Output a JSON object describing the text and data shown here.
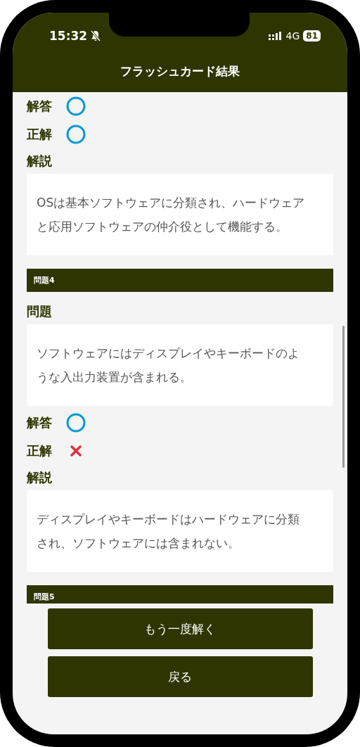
{
  "status_bar": {
    "time": "15:32",
    "silent": true,
    "network": "4G",
    "battery": "81"
  },
  "header": {
    "title": "フラッシュカード結果"
  },
  "questions": [
    {
      "answer_label": "解答",
      "answer_ok": true,
      "correct_label": "正解",
      "correct_ok": true,
      "explanation_label": "解説",
      "explanation": "OSは基本ソフトウェアに分類され、ハードウェアと応用ソフトウェアの仲介役として機能する。"
    },
    {
      "heading": "問題4",
      "question_label": "問題",
      "question": "ソフトウェアにはディスプレイやキーボードのような入出力装置が含まれる。",
      "answer_label": "解答",
      "answer_ok": true,
      "correct_label": "正解",
      "correct_ok": false,
      "explanation_label": "解説",
      "explanation": "ディスプレイやキーボードはハードウェアに分類され、ソフトウェアには含まれない。"
    },
    {
      "heading": "問題5"
    }
  ],
  "buttons": [
    {
      "label": "もう一度解く"
    },
    {
      "label": "戻る"
    }
  ]
}
